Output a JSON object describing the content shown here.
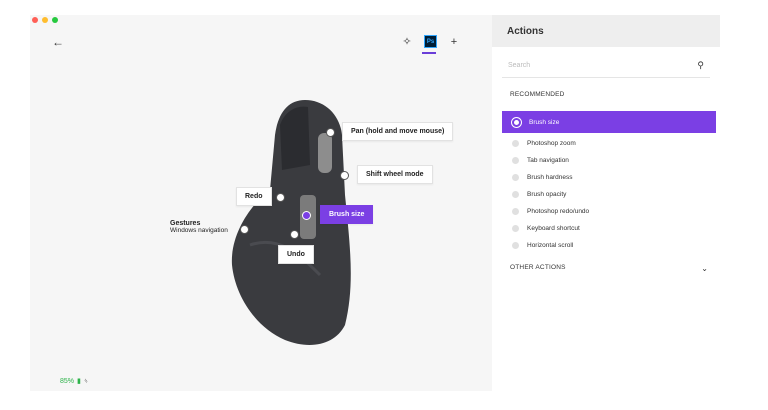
{
  "colors": {
    "accent": "#7b3fe4",
    "battery": "#2db34a"
  },
  "window": {
    "traffic_lights": [
      "#ff5f56",
      "#ffbd2e",
      "#27c93f"
    ]
  },
  "toolbar": {
    "back_icon": "arrow-left-icon",
    "icons": [
      "settings-icon",
      "photoshop-app-icon",
      "add-icon"
    ],
    "ps_label": "Ps"
  },
  "mouse": {
    "callouts": {
      "pan": "Pan (hold and move mouse)",
      "shift_wheel": "Shift wheel mode",
      "redo": "Redo",
      "brush_size": "Brush size",
      "undo": "Undo"
    },
    "gestures": {
      "title": "Gestures",
      "subtitle": "Windows navigation"
    }
  },
  "battery": {
    "percent": "85%"
  },
  "actions_panel": {
    "title": "Actions",
    "search_placeholder": "Search",
    "recommended_label": "RECOMMENDED",
    "items": [
      {
        "label": "Brush size",
        "selected": true
      },
      {
        "label": "Photoshop zoom",
        "selected": false
      },
      {
        "label": "Tab navigation",
        "selected": false
      },
      {
        "label": "Brush hardness",
        "selected": false
      },
      {
        "label": "Brush opacity",
        "selected": false
      },
      {
        "label": "Photoshop redo/undo",
        "selected": false
      },
      {
        "label": "Keyboard shortcut",
        "selected": false
      },
      {
        "label": "Horizontal scroll",
        "selected": false
      }
    ],
    "other_actions_label": "OTHER ACTIONS"
  }
}
